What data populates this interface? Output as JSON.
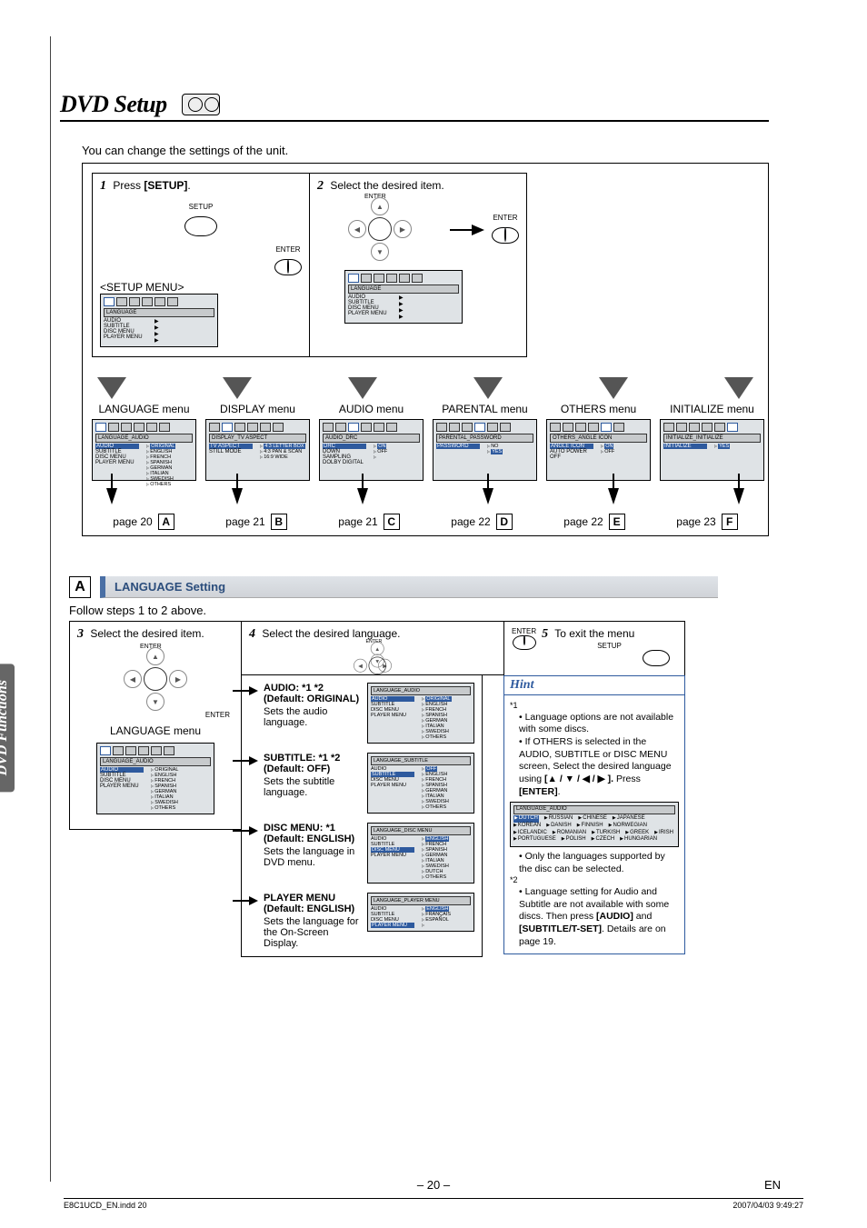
{
  "page_title": "DVD Setup",
  "side_tab": "DVD Functions",
  "intro": "You can change the settings of the unit.",
  "step1": {
    "num": "1",
    "text": "Press ",
    "bold": "[SETUP]",
    "btn_label_top": "SETUP",
    "btn_label_bottom": "ENTER",
    "submenu_caption": "<SETUP MENU>"
  },
  "step2": {
    "num": "2",
    "text": "Select the desired item.",
    "enter_label": "ENTER"
  },
  "osd_common": {
    "cat": "LANGUAGE",
    "rows_left": [
      "AUDIO",
      "SUBTITLE",
      "DISC MENU",
      "PLAYER MENU"
    ],
    "carets": "▶"
  },
  "menus": [
    {
      "label": "LANGUAGE menu",
      "header": "LANGUAGE_AUDIO",
      "left": [
        "AUDIO",
        "SUBTITLE",
        "DISC MENU",
        "PLAYER MENU"
      ],
      "right": [
        "ORIGINAL",
        "ENGLISH",
        "FRENCH",
        "SPANISH",
        "GERMAN",
        "ITALIAN",
        "SWEDISH",
        "OTHERS"
      ],
      "sel": "AUDIO",
      "selR": "ORIGINAL",
      "page": "page 20",
      "letter": "A"
    },
    {
      "label": "DISPLAY menu",
      "header": "DISPLAY_TV ASPECT",
      "left": [
        "TV ASPECT",
        "STILL MODE"
      ],
      "right": [
        "4:3 LETTER BOX",
        "4:3 PAN & SCAN",
        "16:9 WIDE"
      ],
      "sel": "TV ASPECT",
      "selR": "4:3 LETTER BOX",
      "page": "page 21",
      "letter": "B"
    },
    {
      "label": "AUDIO menu",
      "header": "AUDIO_DRC",
      "left": [
        "DRC",
        "DOWN SAMPLING",
        "DOLBY DIGITAL"
      ],
      "right": [
        "ON",
        "OFF",
        ""
      ],
      "sel": "DRC",
      "selR": "ON",
      "page": "page 21",
      "letter": "C"
    },
    {
      "label": "PARENTAL menu",
      "header": "PARENTAL_PASSWORD",
      "left": [
        "PASSWORD"
      ],
      "right": [
        "NO",
        "YES"
      ],
      "sel": "PASSWORD",
      "selR": "YES",
      "page": "page 22",
      "letter": "D"
    },
    {
      "label": "OTHERS menu",
      "header": "OTHERS_ANGLE ICON",
      "left": [
        "ANGLE ICON",
        "AUTO POWER OFF"
      ],
      "right": [
        "ON",
        "OFF"
      ],
      "sel": "ANGLE ICON",
      "selR": "ON",
      "page": "page 22",
      "letter": "E"
    },
    {
      "label": "INITIALIZE menu",
      "header": "INITIALIZE_INITIALIZE",
      "left": [
        "INITIALIZE"
      ],
      "right": [
        "YES"
      ],
      "sel": "INITIALIZE",
      "selR": "YES",
      "page": "page 23",
      "letter": "F"
    }
  ],
  "sectionA": {
    "letter": "A",
    "title": "LANGUAGE Setting",
    "follow": "Follow steps 1 to 2 above."
  },
  "step3": {
    "num": "3",
    "text": "Select the desired item.",
    "enter": "ENTER",
    "menu_label": "LANGUAGE menu",
    "osd_header": "LANGUAGE_AUDIO",
    "osd_left": [
      "AUDIO",
      "SUBTITLE",
      "DISC MENU",
      "PLAYER MENU"
    ],
    "osd_right": [
      "ORIGINAL",
      "ENGLISH",
      "FRENCH",
      "SPANISH",
      "GERMAN",
      "ITALIAN",
      "SWEDISH",
      "OTHERS"
    ]
  },
  "step4": {
    "num": "4",
    "text": "Select the desired language.",
    "enter": "ENTER",
    "items": [
      {
        "title": "AUDIO: *1 *2",
        "default": "(Default: ORIGINAL)",
        "desc": "Sets the audio language.",
        "osd_header": "LANGUAGE_AUDIO",
        "left": [
          "AUDIO",
          "SUBTITLE",
          "DISC MENU",
          "PLAYER MENU"
        ],
        "right": [
          "ORIGINAL",
          "ENGLISH",
          "FRENCH",
          "SPANISH",
          "GERMAN",
          "ITALIAN",
          "SWEDISH",
          "OTHERS"
        ],
        "selR": "ORIGINAL"
      },
      {
        "title": "SUBTITLE: *1 *2",
        "default": "(Default: OFF)",
        "desc": "Sets the subtitle language.",
        "osd_header": "LANGUAGE_SUBTITLE",
        "left": [
          "AUDIO",
          "SUBTITLE",
          "DISC MENU",
          "PLAYER MENU"
        ],
        "right": [
          "OFF",
          "ENGLISH",
          "FRENCH",
          "SPANISH",
          "GERMAN",
          "ITALIAN",
          "SWEDISH",
          "OTHERS"
        ],
        "selR": "OFF"
      },
      {
        "title": "DISC MENU: *1",
        "default": "(Default: ENGLISH)",
        "desc": "Sets the language in DVD menu.",
        "osd_header": "LANGUAGE_DISC MENU",
        "left": [
          "AUDIO",
          "SUBTITLE",
          "DISC MENU",
          "PLAYER MENU"
        ],
        "right": [
          "ENGLISH",
          "FRENCH",
          "SPANISH",
          "GERMAN",
          "ITALIAN",
          "SWEDISH",
          "DUTCH",
          "OTHERS"
        ],
        "selR": "ENGLISH"
      },
      {
        "title": "PLAYER MENU",
        "default": "(Default: ENGLISH)",
        "desc": "Sets the language for the On-Screen Display.",
        "osd_header": "LANGUAGE_PLAYER MENU",
        "left": [
          "AUDIO",
          "SUBTITLE",
          "DISC MENU",
          "PLAYER MENU"
        ],
        "right": [
          "ENGLISH",
          "FRANÇAIS",
          "ESPAÑOL",
          ""
        ],
        "selR": "ENGLISH"
      }
    ]
  },
  "step5": {
    "num": "5",
    "text": "To exit the menu",
    "enter": "ENTER",
    "btn": "SETUP"
  },
  "hint": {
    "title": "Hint",
    "star1": "*1",
    "b1": "Language options are not available with some discs.",
    "b2a": "If OTHERS is selected in the AUDIO, SUBTITLE or DISC MENU screen, Select the desired language using ",
    "b2b": "[▲ / ▼ / ◀ / ▶ ].",
    "b2c": " Press ",
    "b2d": "[ENTER]",
    "b2e": ".",
    "osd_header": "LANGUAGE_AUDIO",
    "langs": [
      "DUTCH",
      "RUSSIAN",
      "CHINESE",
      "JAPANESE",
      "KOREAN",
      "DANISH",
      "FINNISH",
      "NORWEGIAN",
      "ICELANDIC",
      "ROMANIAN",
      "TURKISH",
      "GREEK",
      "IRISH",
      "PORTUGUESE",
      "POLISH",
      "CZECH",
      "HUNGARIAN"
    ],
    "sel_lang": "DUTCH",
    "b3": "Only the languages supported by the disc can be selected.",
    "star2": "*2",
    "b4a": "Language setting for Audio and Subtitle are not available with some discs. Then press ",
    "b4b": "[AUDIO]",
    "b4c": " and ",
    "b4d": "[SUBTITLE/T-SET]",
    "b4e": ". Details are on page 19."
  },
  "page_number": "– 20 –",
  "page_lang": "EN",
  "footer_file": "E8C1UCD_EN.indd   20",
  "footer_time": "2007/04/03   9:49:27"
}
